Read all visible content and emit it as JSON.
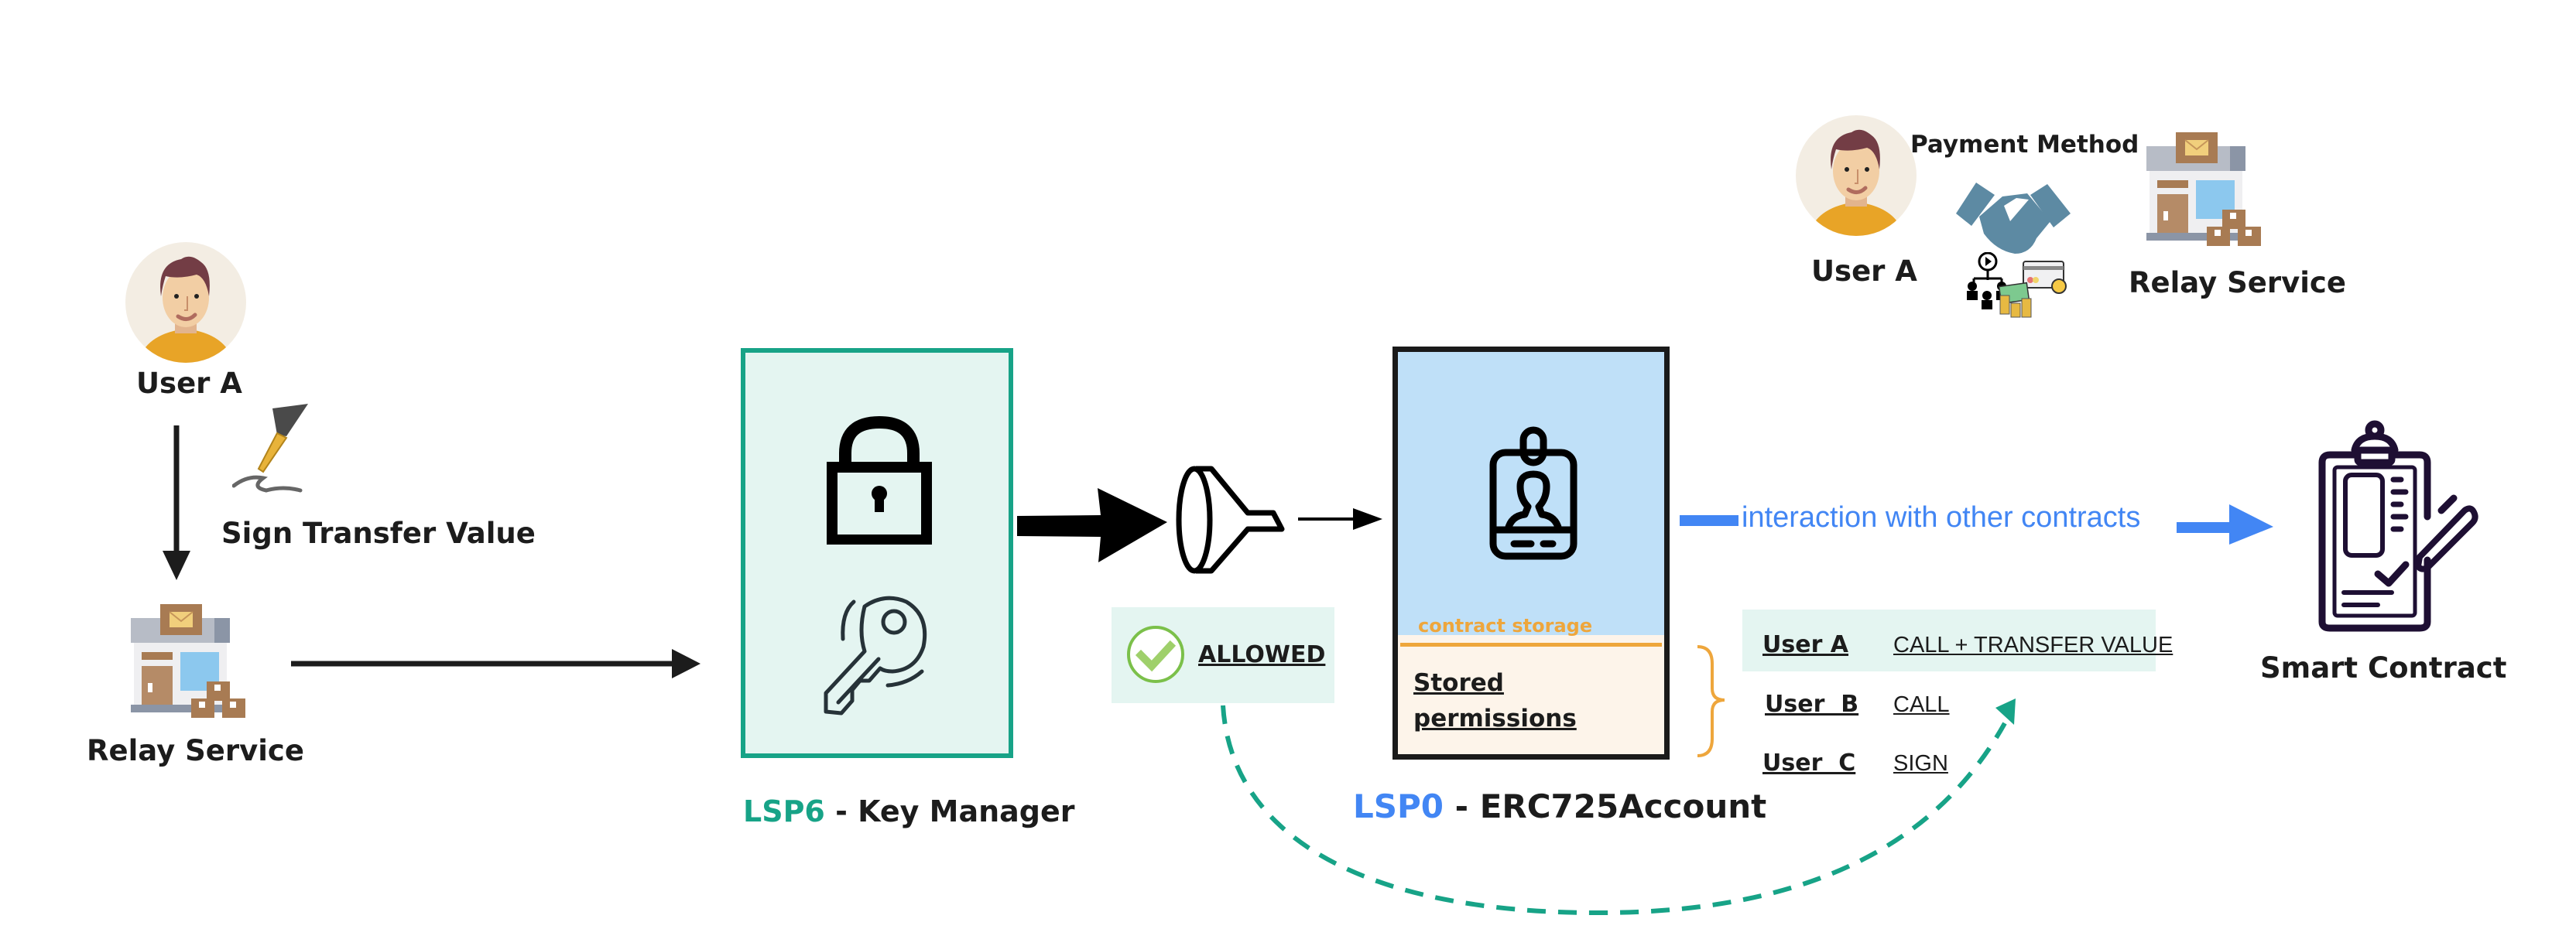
{
  "colors": {
    "teal": "#17a387",
    "teal_bg": "#e4f5f1",
    "blue": "#4286f4",
    "orange": "#eea63c",
    "account_blue_bg": "#bfe0f8",
    "storage_bg": "#fdf4ea",
    "dark": "#1c1c1c",
    "clipboard_purple": "#1e0f33"
  },
  "left_flow": {
    "user_label": "User A",
    "sign_label": "Sign Transfer Value",
    "relay_label": "Relay Service"
  },
  "key_manager": {
    "prefix": "LSP6",
    "title": " - Key Manager"
  },
  "filter": {
    "allowed_label": "ALLOWED"
  },
  "account": {
    "prefix": "LSP0",
    "title": " - ERC725Account",
    "storage_label": "contract storage",
    "stored_permissions_label": "Stored permissions"
  },
  "permissions": [
    {
      "user": "User A",
      "permission": "CALL + TRANSFER VALUE",
      "highlighted": true
    },
    {
      "user": "User  B",
      "permission": "CALL",
      "highlighted": false
    },
    {
      "user": "User  C",
      "permission": "SIGN",
      "highlighted": false
    }
  ],
  "interaction": {
    "label": "interaction with other contracts"
  },
  "smart_contract": {
    "label": "Smart Contract"
  },
  "payment": {
    "user_label": "User A",
    "method_label": "Payment Method",
    "relay_label": "Relay Service"
  }
}
